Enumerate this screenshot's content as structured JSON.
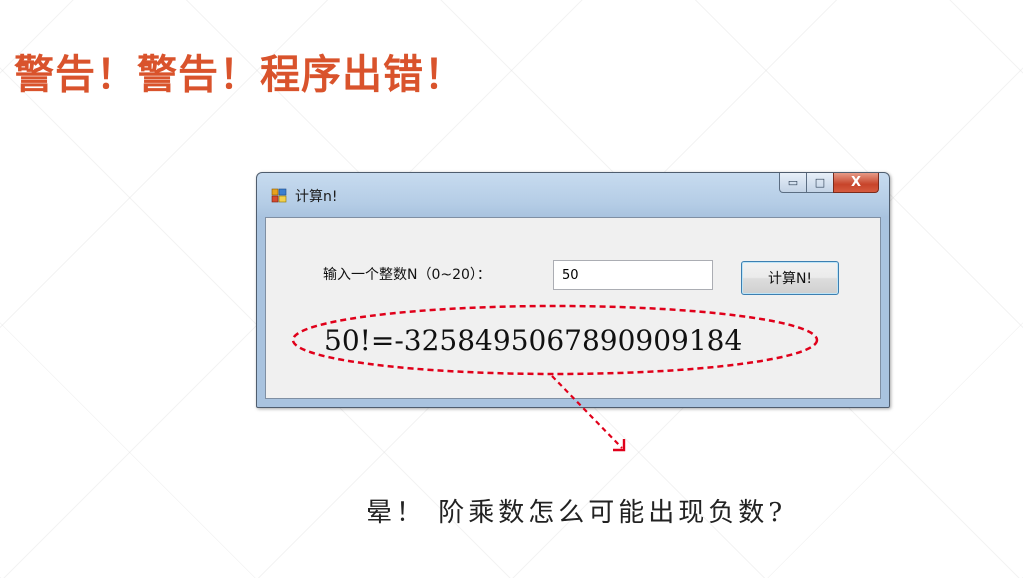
{
  "slide": {
    "title": "警告！警告！程序出错！",
    "caption": "晕！ 阶乘数怎么可能出现负数?"
  },
  "window": {
    "title": "计算n!",
    "controls": {
      "minimize_glyph": "▭",
      "maximize_glyph": "□",
      "close_glyph": "X"
    },
    "form": {
      "input_label": "输入一个整数N（0~20）：",
      "input_value": "50",
      "button_label": "计算N!",
      "result_text": "50!=-3258495067890909184"
    }
  },
  "colors": {
    "title": "#d9532c",
    "annotation": "#e0001a"
  }
}
